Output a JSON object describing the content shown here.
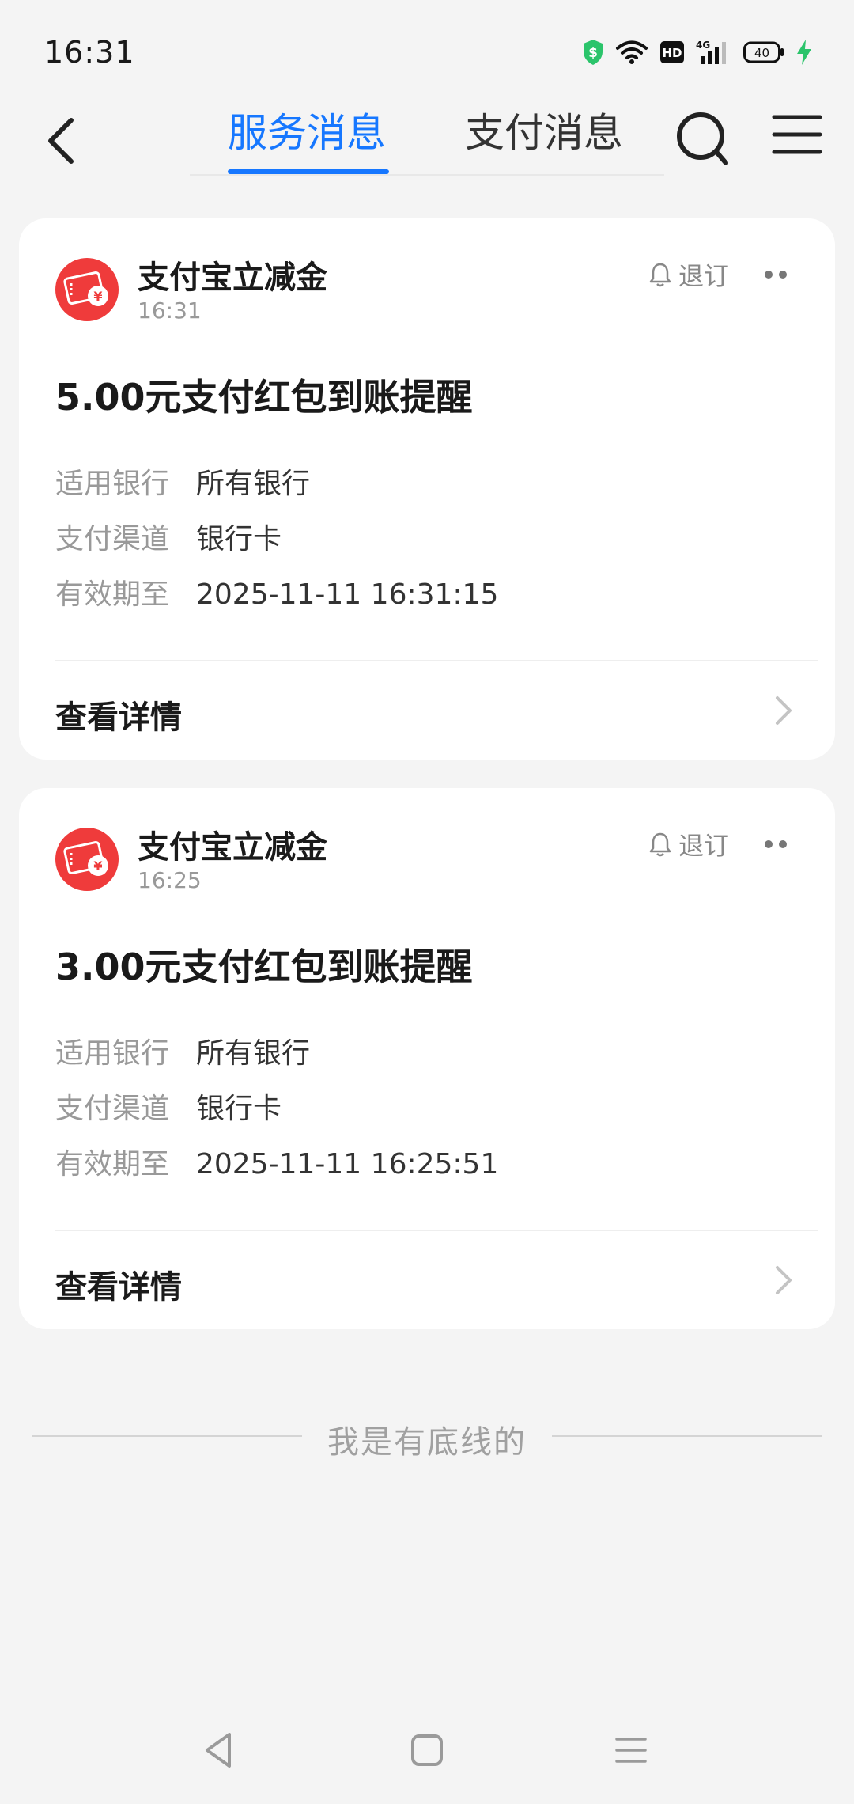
{
  "status_bar": {
    "time": "16:31",
    "icons": [
      "shield-dollar-icon",
      "wifi-icon",
      "hd-icon",
      "signal-4g-icon",
      "battery-icon",
      "charging-icon"
    ],
    "network": "4G",
    "battery_level": "40"
  },
  "header": {
    "back_icon": "chevron-left-icon",
    "tabs": [
      {
        "label": "服务消息",
        "active": true
      },
      {
        "label": "支付消息",
        "active": false
      }
    ],
    "search_icon": "search-icon",
    "menu_icon": "menu-icon"
  },
  "messages": [
    {
      "sender": "支付宝立减金",
      "time": "16:31",
      "unsubscribe_label": "退订",
      "title": "5.00元支付红包到账提醒",
      "fields": [
        {
          "key": "适用银行",
          "value": "所有银行"
        },
        {
          "key": "支付渠道",
          "value": "银行卡"
        },
        {
          "key": "有效期至",
          "value": "2025-11-11 16:31:15"
        }
      ],
      "detail_label": "查看详情"
    },
    {
      "sender": "支付宝立减金",
      "time": "16:25",
      "unsubscribe_label": "退订",
      "title": "3.00元支付红包到账提醒",
      "fields": [
        {
          "key": "适用银行",
          "value": "所有银行"
        },
        {
          "key": "支付渠道",
          "value": "银行卡"
        },
        {
          "key": "有效期至",
          "value": "2025-11-11 16:25:51"
        }
      ],
      "detail_label": "查看详情"
    }
  ],
  "footer": {
    "end_text": "我是有底线的"
  },
  "system_nav": [
    "back-triangle-icon",
    "home-square-icon",
    "recents-lines-icon"
  ],
  "colors": {
    "accent": "#1677ff",
    "background": "#f4f4f4",
    "card": "#ffffff",
    "avatar_red": "#ef3b3b",
    "status_green": "#2bc46b"
  }
}
